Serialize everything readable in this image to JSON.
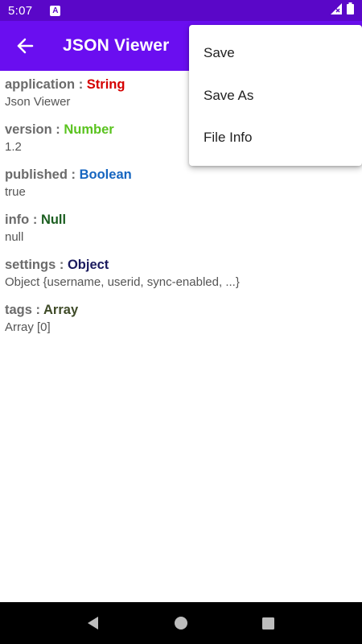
{
  "status_bar": {
    "time": "5:07",
    "notification_icon_letter": "A",
    "icons": [
      "notification-a-icon",
      "signal-icon",
      "battery-icon"
    ]
  },
  "app_bar": {
    "title": "JSON Viewer",
    "color": "#6a0ef0",
    "back_icon": "arrow-left-icon"
  },
  "entries": [
    {
      "key": "application",
      "type": "String",
      "type_color": "#d50000",
      "value": "Json Viewer"
    },
    {
      "key": "version",
      "type": "Number",
      "type_color": "#5ac31f",
      "value": "1.2"
    },
    {
      "key": "published",
      "type": "Boolean",
      "type_color": "#1565c0",
      "value": "true"
    },
    {
      "key": "info",
      "type": "Null",
      "type_color": "#1b5e20",
      "value": "null"
    },
    {
      "key": "settings",
      "type": "Object",
      "type_color": "#1a1a5e",
      "value": "Object {username, userid, sync-enabled, ...}"
    },
    {
      "key": "tags",
      "type": "Array",
      "type_color": "#3e4a27",
      "value": "Array [0]"
    }
  ],
  "separator": ":",
  "menu": {
    "items": [
      "Save",
      "Save As",
      "File Info"
    ]
  },
  "nav_bar": {
    "buttons": [
      "back-triangle-icon",
      "home-circle-icon",
      "recents-square-icon"
    ]
  }
}
